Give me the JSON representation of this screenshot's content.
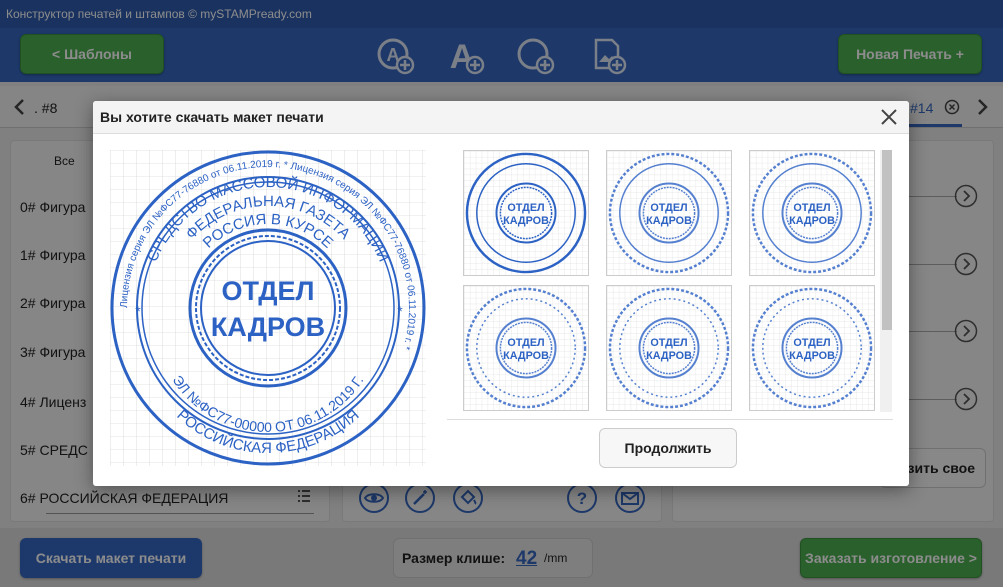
{
  "window": {
    "title": "Конструктор печатей и штампов © mySTAMPready.com"
  },
  "header": {
    "templates_label": "<  Шаблоны",
    "new_stamp_label": "Новая Печать +",
    "tools": [
      "add-text-circle-icon",
      "add-text-icon",
      "add-circle-icon",
      "add-image-icon"
    ]
  },
  "tabs": {
    "left_label": ". #8",
    "right_label": "#14"
  },
  "left_panel": {
    "filter_label": "Все",
    "rows": [
      {
        "index": "0#",
        "text": "Фигура"
      },
      {
        "index": "1#",
        "text": "Фигура"
      },
      {
        "index": "2#",
        "text": "Фигура"
      },
      {
        "index": "3#",
        "text": "Фигура"
      },
      {
        "index": "4#",
        "text": "Лиценз"
      },
      {
        "index": "5#",
        "text": "СРЕДС"
      },
      {
        "index": "6#",
        "text": "РОССИЙСКАЯ ФЕДЕРАЦИЯ"
      }
    ]
  },
  "right_panel": {
    "upload_label": "узить свое"
  },
  "footer": {
    "download_label": "Скачать макет печати",
    "size_label": "Размер клише:",
    "size_value": "42",
    "size_unit": "/mm",
    "order_label": "Заказать изготовление >"
  },
  "modal": {
    "title": "Вы хотите скачать макет печати",
    "continue_label": "Продолжить",
    "stamp": {
      "center_line1": "ОТДЕЛ",
      "center_line2": "КАДРОВ",
      "ring_top": "СРЕДСТВО МАССОВОЙ ИНФОРМАЦИИ",
      "ring_top2": "ФЕДЕРАЛЬНАЯ ГАЗЕТА",
      "ring_top3": "РОССИЯ В КУРСЕ",
      "ring_bottom": "РОССИЙСКАЯ ФЕДЕРАЦИЯ",
      "ring_bottom2": "ЭЛ №ФС77-00000 ОТ 06.11.2019 Г.",
      "outer_ring": "Лицензия серия ЭЛ №ФС77-76880 от 06.11.2019 г. * Лицензия серия ЭЛ №ФС77-76880 от 06.11.2019 г. *"
    }
  },
  "colors": {
    "stamp_blue": "#2c62c4",
    "accent_green": "#4caf50",
    "bar_blue": "#3567c0"
  }
}
